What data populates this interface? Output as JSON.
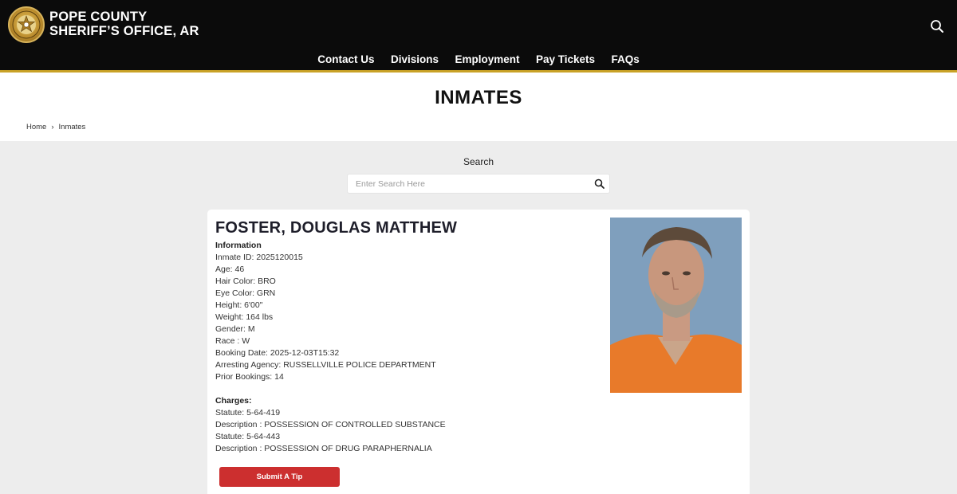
{
  "header": {
    "brand_line1": "POPE COUNTY",
    "brand_line2": "SHERIFF’S OFFICE, AR",
    "search_icon": "search-icon",
    "logo": {
      "icon": "sheriff-badge-icon",
      "text_top": "SHERIFF",
      "text_bottom": "POPE COUNTY"
    }
  },
  "nav": {
    "items": [
      {
        "label": "Contact Us"
      },
      {
        "label": "Divisions"
      },
      {
        "label": "Employment"
      },
      {
        "label": "Pay Tickets"
      },
      {
        "label": "FAQs"
      }
    ]
  },
  "page": {
    "title": "INMATES",
    "breadcrumb": [
      "Home",
      "Inmates"
    ],
    "breadcrumb_separator": "›"
  },
  "search": {
    "label": "Search",
    "placeholder": "Enter Search Here",
    "value": ""
  },
  "inmate": {
    "name": "FOSTER, DOUGLAS MATTHEW",
    "info_heading": "Information",
    "fields": [
      "Inmate ID: 2025120015",
      "Age: 46",
      "Hair Color: BRO",
      "Eye Color: GRN",
      "Height: 6'00\"",
      "Weight: 164 lbs",
      "Gender: M",
      "Race : W",
      "Booking Date: 2025-12-03T15:32",
      "Arresting Agency: RUSSELLVILLE POLICE DEPARTMENT",
      "Prior Bookings: 14"
    ],
    "charges_heading": "Charges:",
    "charges": [
      "Statute: 5-64-419",
      "Description : POSSESSION OF CONTROLLED SUBSTANCE",
      "Statute: 5-64-443",
      "Description : POSSESSION OF DRUG PARAPHERNALIA"
    ],
    "tip_button": "Submit A Tip"
  },
  "colors": {
    "header_bg": "#0b0b0b",
    "accent_gold": "#c9a227",
    "tip_red": "#cc2f2f",
    "page_bg": "#ededed"
  }
}
